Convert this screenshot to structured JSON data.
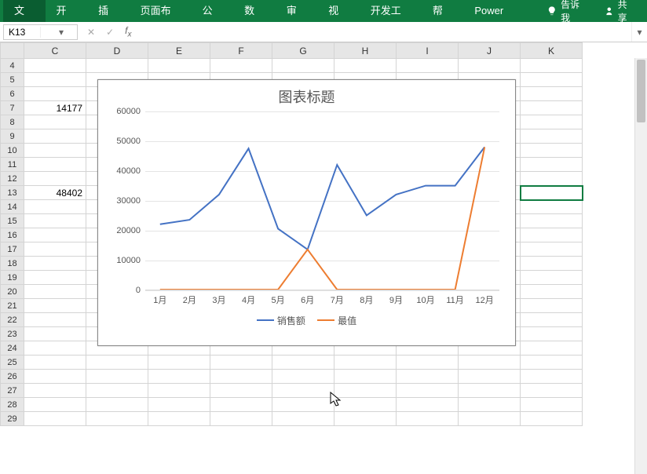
{
  "ribbon": {
    "tabs": [
      "文件",
      "开始",
      "插入",
      "页面布局",
      "公式",
      "数据",
      "审阅",
      "视图",
      "开发工具",
      "帮助",
      "Power Pivot"
    ],
    "tellme": "告诉我",
    "share": "共享"
  },
  "namebox": {
    "value": "K13"
  },
  "cells": {
    "C7": "14177",
    "C13": "48402"
  },
  "columns": [
    "C",
    "D",
    "E",
    "F",
    "G",
    "H",
    "I",
    "J",
    "K"
  ],
  "selected_cell": "K13",
  "chart_data": {
    "type": "line",
    "title": "图表标题",
    "categories": [
      "1月",
      "2月",
      "3月",
      "4月",
      "5月",
      "6月",
      "7月",
      "8月",
      "9月",
      "10月",
      "11月",
      "12月"
    ],
    "series": [
      {
        "name": "销售额",
        "color": "#4472c4",
        "values": [
          22000,
          23500,
          32000,
          47500,
          20500,
          13500,
          42000,
          25000,
          32000,
          35000,
          35000,
          48000
        ]
      },
      {
        "name": "最值",
        "color": "#ed7d31",
        "values": [
          0,
          0,
          0,
          0,
          0,
          13500,
          0,
          0,
          0,
          0,
          0,
          48000
        ]
      }
    ],
    "ylabel": "",
    "xlabel": "",
    "ylim": [
      0,
      60000
    ],
    "yticks": [
      0,
      10000,
      20000,
      30000,
      40000,
      50000,
      60000
    ]
  }
}
